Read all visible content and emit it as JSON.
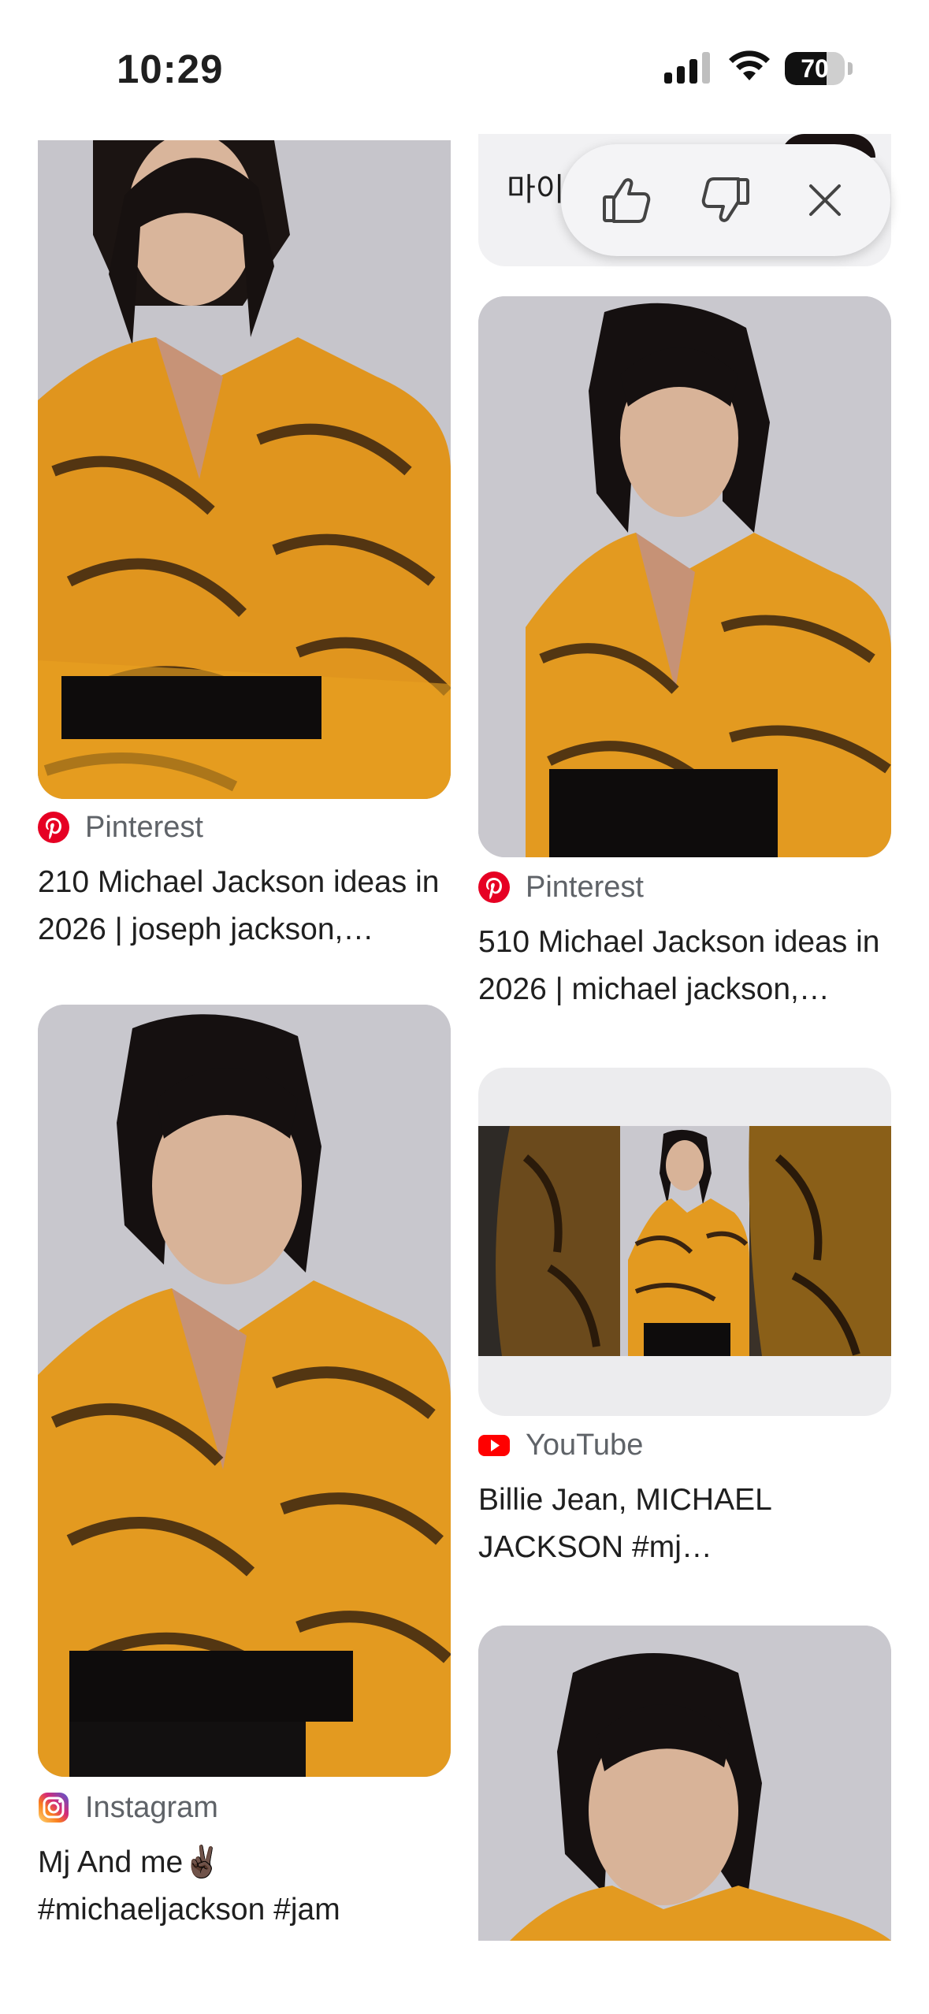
{
  "status_bar": {
    "time": "10:29",
    "battery": "70",
    "battery_level": 0.7
  },
  "feedback_popup": {
    "like_icon": "thumbs-up-icon",
    "dislike_icon": "thumbs-down-icon",
    "close_icon": "close-icon"
  },
  "results": {
    "right_top_partial": {
      "text": "마이"
    },
    "left": [
      {
        "source": "Pinterest",
        "source_icon": "pinterest-icon",
        "title": "210 Michael Jackson ideas in 2026 | joseph jackson,…"
      },
      {
        "source": "Instagram",
        "source_icon": "instagram-icon",
        "title": "Mj And me✌🏿 #michaeljackson #jam"
      }
    ],
    "right": [
      {
        "source": "Pinterest",
        "source_icon": "pinterest-icon",
        "title": "510 Michael Jackson ideas in 2026 | michael jackson,…"
      },
      {
        "source": "YouTube",
        "source_icon": "youtube-icon",
        "title": "Billie Jean, MICHAEL JACKSON #mj…"
      },
      {
        "source": "",
        "source_icon": "",
        "title": ""
      }
    ]
  },
  "colors": {
    "pinterest": "#e60023",
    "youtube": "#ff0000",
    "text": "#1f1f1f",
    "muted": "#5f6368"
  }
}
